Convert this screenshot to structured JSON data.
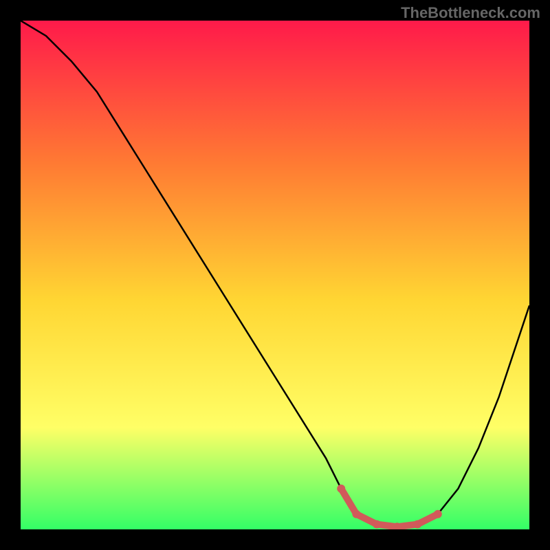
{
  "watermark": "TheBottleneck.com",
  "chart_data": {
    "type": "line",
    "title": "",
    "xlabel": "",
    "ylabel": "",
    "xlim": [
      0,
      100
    ],
    "ylim": [
      0,
      100
    ],
    "background_gradient": {
      "top": "#ff1a4a",
      "upper_mid": "#ff7a33",
      "mid": "#ffd633",
      "lower_mid": "#ffff66",
      "bottom": "#33ff66"
    },
    "curve": {
      "x": [
        0,
        5,
        10,
        15,
        20,
        25,
        30,
        35,
        40,
        45,
        50,
        55,
        60,
        63,
        66,
        70,
        74,
        78,
        82,
        86,
        90,
        94,
        100
      ],
      "y": [
        100,
        97,
        92,
        86,
        78,
        70,
        62,
        54,
        46,
        38,
        30,
        22,
        14,
        8,
        3,
        1,
        0.5,
        1,
        3,
        8,
        16,
        26,
        44
      ]
    },
    "highlight_segment": {
      "x": [
        63,
        66,
        70,
        74,
        78,
        82
      ],
      "y": [
        8,
        3,
        1,
        0.5,
        1,
        3
      ],
      "color": "#d15a5a"
    }
  }
}
